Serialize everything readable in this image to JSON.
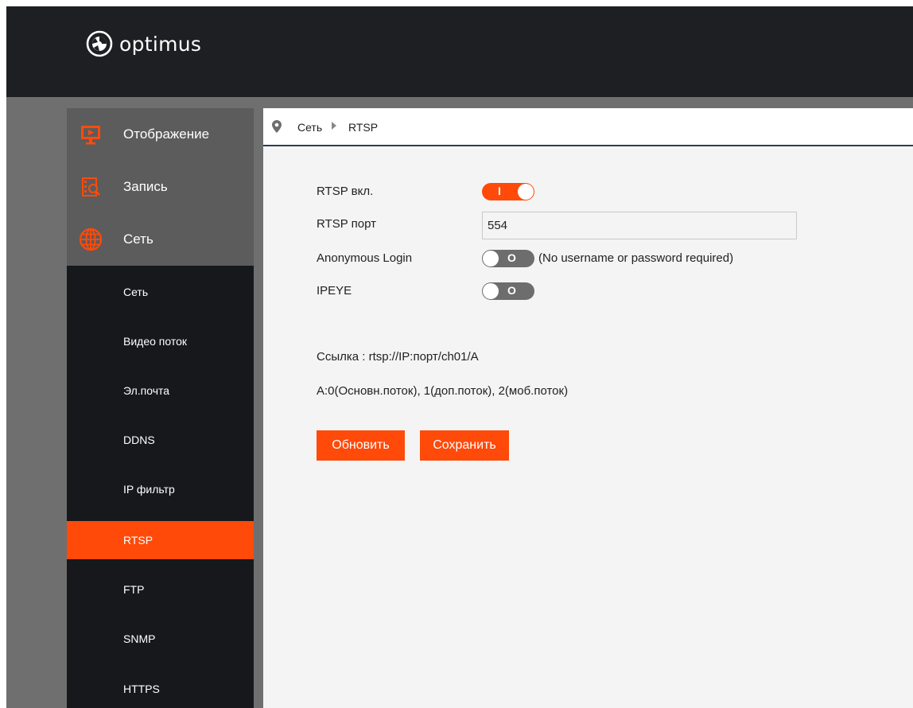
{
  "header": {
    "logo_text": "optimus"
  },
  "sidebar": {
    "categories": [
      {
        "label": "Отображение",
        "icon": "monitor-icon"
      },
      {
        "label": "Запись",
        "icon": "record-search-icon"
      },
      {
        "label": "Сеть",
        "icon": "globe-icon"
      }
    ],
    "sub_items": [
      {
        "label": "Сеть"
      },
      {
        "label": "Видео поток"
      },
      {
        "label": "Эл.почта"
      },
      {
        "label": "DDNS"
      },
      {
        "label": "IP фильтр"
      },
      {
        "label": "RTSP",
        "active": true
      },
      {
        "label": "FTP"
      },
      {
        "label": "SNMP"
      },
      {
        "label": "HTTPS"
      }
    ]
  },
  "breadcrumb": {
    "section": "Сеть",
    "page": "RTSP"
  },
  "form": {
    "rtsp_enable_label": "RTSP вкл.",
    "rtsp_enable_state": "on",
    "rtsp_port_label": "RTSP порт",
    "rtsp_port_value": "554",
    "anonymous_label": "Anonymous Login",
    "anonymous_state": "off",
    "anonymous_hint": "(No username or password required)",
    "ipeye_label": "IPEYE",
    "ipeye_state": "off",
    "toggle_on_glyph": "I",
    "toggle_off_glyph": "O"
  },
  "info": {
    "link_text": "Ссылка : rtsp://IP:порт/ch01/A",
    "streams_text": "A:0(Основн.поток), 1(доп.поток), 2(моб.поток)"
  },
  "buttons": {
    "refresh": "Обновить",
    "save": "Сохранить"
  },
  "colors": {
    "accent": "#ff4a0a",
    "header_bg": "#1d1f22",
    "sidebar_bg": "#16181b",
    "content_bg": "#f4f4f4"
  }
}
